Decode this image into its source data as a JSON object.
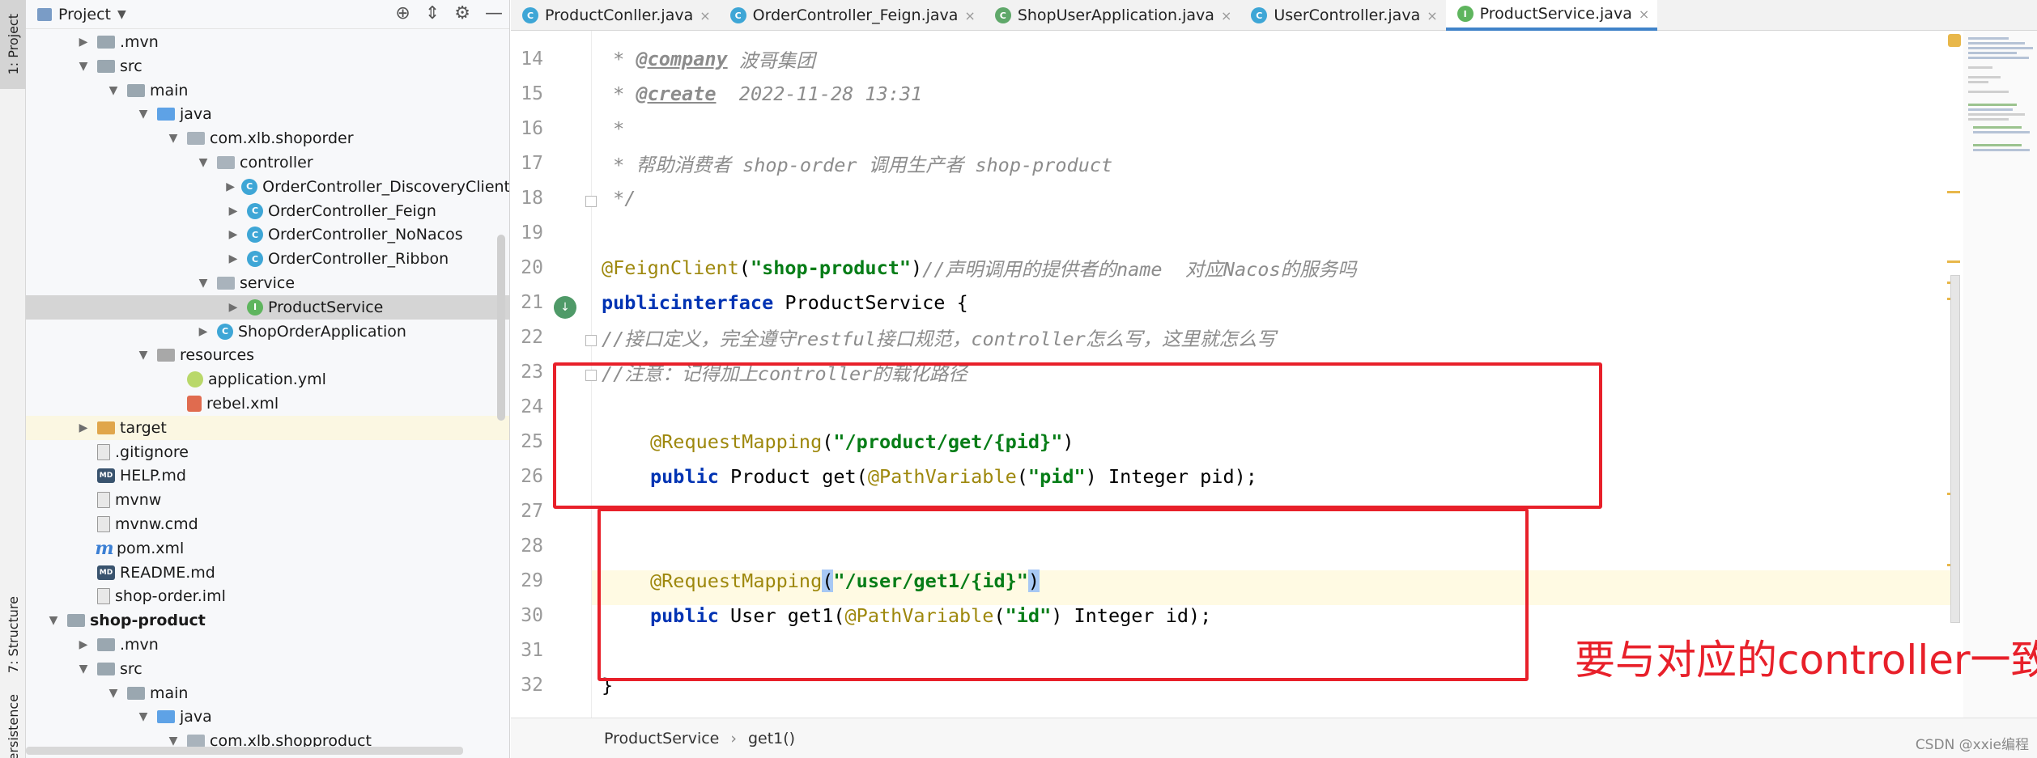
{
  "tool_window_tabs": {
    "project": "1: Project",
    "structure": "7: Structure",
    "persistence": "Persistence"
  },
  "project_panel": {
    "title": "Project",
    "tree": [
      {
        "label": ".mvn",
        "indent": 2,
        "arrow": "right",
        "icon": "folder"
      },
      {
        "label": "src",
        "indent": 2,
        "arrow": "down",
        "icon": "folder"
      },
      {
        "label": "main",
        "indent": 3,
        "arrow": "down",
        "icon": "folder"
      },
      {
        "label": "java",
        "indent": 4,
        "arrow": "down",
        "icon": "folder-src"
      },
      {
        "label": "com.xlb.shoporder",
        "indent": 5,
        "arrow": "down",
        "icon": "package"
      },
      {
        "label": "controller",
        "indent": 6,
        "arrow": "down",
        "icon": "package"
      },
      {
        "label": "OrderController_DiscoveryClient",
        "indent": 7,
        "arrow": "right",
        "icon": "class"
      },
      {
        "label": "OrderController_Feign",
        "indent": 7,
        "arrow": "right",
        "icon": "class"
      },
      {
        "label": "OrderController_NoNacos",
        "indent": 7,
        "arrow": "right",
        "icon": "class"
      },
      {
        "label": "OrderController_Ribbon",
        "indent": 7,
        "arrow": "right",
        "icon": "class"
      },
      {
        "label": "service",
        "indent": 6,
        "arrow": "down",
        "icon": "package"
      },
      {
        "label": "ProductService",
        "indent": 7,
        "arrow": "right",
        "icon": "interface",
        "selected": true
      },
      {
        "label": "ShopOrderApplication",
        "indent": 6,
        "arrow": "right",
        "icon": "class"
      },
      {
        "label": "resources",
        "indent": 4,
        "arrow": "down",
        "icon": "folder-res"
      },
      {
        "label": "application.yml",
        "indent": 5,
        "arrow": "",
        "icon": "yml"
      },
      {
        "label": "rebel.xml",
        "indent": 5,
        "arrow": "",
        "icon": "xml"
      },
      {
        "label": "target",
        "indent": 2,
        "arrow": "right",
        "icon": "folder-target",
        "excluded": true
      },
      {
        "label": ".gitignore",
        "indent": 2,
        "arrow": "",
        "icon": "file"
      },
      {
        "label": "HELP.md",
        "indent": 2,
        "arrow": "",
        "icon": "md"
      },
      {
        "label": "mvnw",
        "indent": 2,
        "arrow": "",
        "icon": "file"
      },
      {
        "label": "mvnw.cmd",
        "indent": 2,
        "arrow": "",
        "icon": "file"
      },
      {
        "label": "pom.xml",
        "indent": 2,
        "arrow": "",
        "icon": "maven"
      },
      {
        "label": "README.md",
        "indent": 2,
        "arrow": "",
        "icon": "md"
      },
      {
        "label": "shop-order.iml",
        "indent": 2,
        "arrow": "",
        "icon": "file"
      },
      {
        "label": "shop-product",
        "indent": 1,
        "arrow": "down",
        "icon": "folder",
        "bold": true
      },
      {
        "label": ".mvn",
        "indent": 2,
        "arrow": "right",
        "icon": "folder"
      },
      {
        "label": "src",
        "indent": 2,
        "arrow": "down",
        "icon": "folder"
      },
      {
        "label": "main",
        "indent": 3,
        "arrow": "down",
        "icon": "folder"
      },
      {
        "label": "java",
        "indent": 4,
        "arrow": "down",
        "icon": "folder-src"
      },
      {
        "label": "com.xlb.shopproduct",
        "indent": 5,
        "arrow": "down",
        "icon": "package"
      }
    ]
  },
  "editor_tabs": [
    {
      "label": "ProductConller.java",
      "icon": "class",
      "active": false
    },
    {
      "label": "OrderController_Feign.java",
      "icon": "class",
      "active": false
    },
    {
      "label": "ShopUserApplication.java",
      "icon": "spring",
      "active": false
    },
    {
      "label": "UserController.java",
      "icon": "class",
      "active": false
    },
    {
      "label": "ProductService.java",
      "icon": "interface",
      "active": true
    }
  ],
  "editor": {
    "line_numbers": [
      "14",
      "15",
      "16",
      "17",
      "18",
      "19",
      "20",
      "21",
      "22",
      "23",
      "24",
      "25",
      "26",
      "27",
      "28",
      "29",
      "30",
      "31",
      "32"
    ],
    "code": {
      "l14_star": " * ",
      "l14_tag": "@company",
      "l14_val": " 波哥集团",
      "l15_star": " * ",
      "l15_tag": "@create",
      "l15_val": "  2022-11-28 13:31",
      "l16": " *",
      "l17": " * 帮助消费者 shop-order 调用生产者 shop-product",
      "l18": " */",
      "l20_ann": "@FeignClient",
      "l20_p1": "(",
      "l20_str": "\"shop-product\"",
      "l20_p2": ")",
      "l20_cmt": "//声明调用的提供者的name  对应Nacos的服务吗",
      "l21_kw1": "public",
      "l21_kw2": "interface",
      "l21_rest": " ProductService {",
      "l22": "//接口定义，完全遵守restful接口规范，controller怎么写，这里就怎么写",
      "l23": "//注意：记得加上controller的载化路径",
      "l25_ann": "@RequestMapping",
      "l25_p1": "(",
      "l25_str": "\"/product/get/{pid}\"",
      "l25_p2": ")",
      "l26_kw": "public",
      "l26_a": " Product get(",
      "l26_ann": "@PathVariable",
      "l26_p1": "(",
      "l26_str": "\"pid\"",
      "l26_b": ") Integer pid);",
      "l29_ann": "@RequestMapping",
      "l29_p1": "(",
      "l29_str": "\"/user/get1/{id}\"",
      "l29_p2": ")",
      "l30_kw": "public",
      "l30_a": " User get1(",
      "l30_ann": "@PathVariable",
      "l30_p1": "(",
      "l30_str": "\"id\"",
      "l30_b": ") Integer id);",
      "l32": "}"
    }
  },
  "annotation": {
    "text": "要与对应的controller一致",
    "color": "#e8202a"
  },
  "breadcrumb": {
    "items": [
      "ProductService",
      "get1()"
    ]
  },
  "watermark": "CSDN @xxie编程",
  "colors": {
    "keyword": "#0033b3",
    "annotation": "#9e880d",
    "string": "#067d17",
    "comment": "#8c8c8c",
    "accent": "#4083c9"
  }
}
